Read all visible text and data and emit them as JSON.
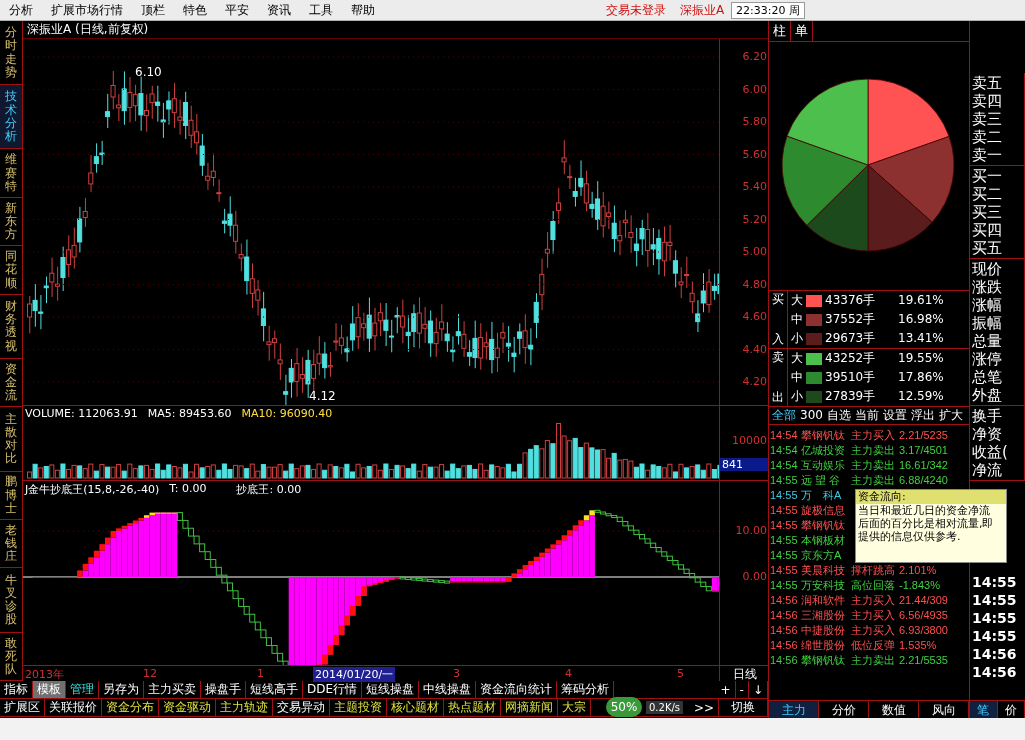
{
  "menu": {
    "items": [
      "分析",
      "扩展市场行情",
      "顶栏",
      "特色",
      "平安",
      "资讯",
      "工具",
      "帮助"
    ],
    "status": [
      "交易未登录",
      "深振业A"
    ],
    "clock": "22:33:20 周"
  },
  "left_tabs": [
    {
      "label": "分时走势",
      "selected": false
    },
    {
      "label": "技术分析",
      "selected": true
    },
    {
      "label": "维赛特",
      "selected": false
    },
    {
      "label": "新东方",
      "selected": false
    },
    {
      "label": "同花顺",
      "selected": false
    },
    {
      "label": "财务透视",
      "selected": false
    },
    {
      "label": "资金流",
      "selected": false
    },
    {
      "label": "主散对比",
      "selected": false
    },
    {
      "label": "鹏博士",
      "selected": false
    },
    {
      "label": "老钱庄",
      "selected": false
    },
    {
      "label": "牛叉诊股",
      "selected": false
    },
    {
      "label": "敢死队",
      "selected": false
    }
  ],
  "price_chart": {
    "title": "深振业A (日线,前复权)",
    "high_label": "6.10",
    "low_label": "4.12",
    "axis": [
      "6.20",
      "6.00",
      "5.80",
      "5.60",
      "5.40",
      "5.20",
      "5.00",
      "4.80",
      "4.60",
      "4.40",
      "4.20"
    ]
  },
  "volume_chart": {
    "readings": [
      "VOLUME: 112063.91",
      "MA5: 89453.60",
      "MA10: 96090.40"
    ],
    "axis": [
      "10000"
    ],
    "cursor_value": "841"
  },
  "indicator_chart": {
    "name": "J金牛抄底王(15,8,-26,-40)",
    "t_reading": "T: 0.00",
    "reading": "抄底王: 0.00",
    "axis": [
      "10.00",
      "0.00"
    ]
  },
  "x_axis": {
    "labels": [
      {
        "label": "2013年",
        "selected": false
      },
      {
        "label": "12",
        "selected": false
      },
      {
        "label": "1",
        "selected": false
      },
      {
        "label": "2014/01/20/一",
        "selected": true
      },
      {
        "label": "3",
        "selected": false
      },
      {
        "label": "4",
        "selected": false
      },
      {
        "label": "5",
        "selected": false
      }
    ],
    "period": "日线"
  },
  "toolbar": [
    {
      "label": "指标",
      "selected": false
    },
    {
      "label": "模板",
      "selected": true
    },
    {
      "label": "管理",
      "selected": false,
      "kind": "active"
    },
    {
      "label": "另存为",
      "selected": false
    },
    {
      "label": "主力买卖",
      "selected": false
    },
    {
      "label": "操盘手",
      "selected": false
    },
    {
      "label": "短线高手",
      "selected": false
    },
    {
      "label": "DDE行情",
      "selected": false
    },
    {
      "label": "短线操盘",
      "selected": false
    },
    {
      "label": "中线操盘",
      "selected": false
    },
    {
      "label": "资金流向统计",
      "selected": false
    },
    {
      "label": "筹码分析",
      "selected": false
    }
  ],
  "zoom_buttons": [
    "+",
    "-",
    "↓"
  ],
  "ext_bar": [
    {
      "label": "扩展区",
      "kind": "basic"
    },
    {
      "label": "关联报价",
      "kind": "basic"
    },
    {
      "label": "资金分布",
      "kind": "feature"
    },
    {
      "label": "资金驱动",
      "kind": "feature"
    },
    {
      "label": "主力轨迹",
      "kind": "feature"
    },
    {
      "label": "交易异动",
      "kind": "basic"
    },
    {
      "label": "主题投资",
      "kind": "feature"
    },
    {
      "label": "核心题材",
      "kind": "feature"
    },
    {
      "label": "热点题材",
      "kind": "feature"
    },
    {
      "label": "网摘新闻",
      "kind": "feature"
    },
    {
      "label": "大宗",
      "kind": "feature"
    }
  ],
  "ext_more": ">>",
  "switch_button": "切换",
  "net_widget": {
    "percent": "50%",
    "speed": "0.2K/s"
  },
  "right_panel": {
    "tabs": [
      {
        "label": "柱",
        "selected": false
      },
      {
        "label": "单",
        "selected": false
      }
    ],
    "pie": {
      "chart_data": {
        "type": "pie",
        "series": [
          {
            "values": [
              19.61,
              16.98,
              13.41,
              12.59,
              17.86,
              19.55
            ]
          }
        ]
      }
    },
    "legend": [
      {
        "top": "买",
        "bottom": "入",
        "rows": [
          {
            "size": "大",
            "color": "#ff5252",
            "volume": "43376手",
            "percent": "19.61%"
          },
          {
            "size": "中",
            "color": "#8c3030",
            "volume": "37552手",
            "percent": "16.98%"
          },
          {
            "size": "小",
            "color": "#5a1c1c",
            "volume": "29673手",
            "percent": "13.41%"
          }
        ]
      },
      {
        "top": "卖",
        "bottom": "出",
        "rows": [
          {
            "size": "大",
            "color": "#4cbf4c",
            "volume": "43252手",
            "percent": "19.55%"
          },
          {
            "size": "中",
            "color": "#2e8a2e",
            "volume": "39510手",
            "percent": "17.86%"
          },
          {
            "size": "小",
            "color": "#1c4a1c",
            "volume": "27839手",
            "percent": "12.59%"
          }
        ]
      }
    ],
    "filters": [
      {
        "label": "全部",
        "selected": true
      },
      {
        "label": "300",
        "selected": false
      },
      {
        "label": "自选",
        "selected": false
      },
      {
        "label": "当前",
        "selected": false
      },
      {
        "label": "设置",
        "selected": false
      },
      {
        "label": "浮出",
        "selected": false
      },
      {
        "label": "扩大",
        "selected": false
      }
    ],
    "stream": [
      {
        "time": "14:54",
        "stock": "攀钢钒钛",
        "action": "主力买入",
        "value": "2.21/5235",
        "color": "#ff5050"
      },
      {
        "time": "14:54",
        "stock": "亿城投资",
        "action": "主力卖出",
        "value": "3.17/4501",
        "color": "#40d040"
      },
      {
        "time": "14:54",
        "stock": "互动娱乐",
        "action": "主力卖出",
        "value": "16.61/342",
        "color": "#40d040"
      },
      {
        "time": "14:55",
        "stock": "远 望 谷",
        "action": "主力卖出",
        "value": "6.88/4240",
        "color": "#40d040"
      },
      {
        "time": "14:55",
        "stock": "万　科A",
        "color": "#40c8e0"
      },
      {
        "time": "14:55",
        "stock": "旋极信息",
        "color": "#ff5050"
      },
      {
        "time": "14:55",
        "stock": "攀钢钒钛",
        "color": "#ff5050"
      },
      {
        "time": "14:55",
        "stock": "本钢板材",
        "color": "#40d040"
      },
      {
        "time": "14:55",
        "stock": "京东方A",
        "color": "#40d040"
      },
      {
        "time": "14:55",
        "stock": "美晨科技",
        "action": "撑杆跳高",
        "value": "2.101%",
        "color": "#ff5050"
      },
      {
        "time": "14:55",
        "stock": "万安科技",
        "action": "高位回落",
        "value": "-1.843%",
        "color": "#40d040"
      },
      {
        "time": "14:56",
        "stock": "润和软件",
        "action": "主力买入",
        "value": "21.44/309",
        "color": "#ff5050"
      },
      {
        "time": "14:56",
        "stock": "三湘股份",
        "action": "主力买入",
        "value": "6.56/4935",
        "color": "#ff5050"
      },
      {
        "time": "14:56",
        "stock": "中捷股份",
        "action": "主力买入",
        "value": "6.93/3800",
        "color": "#ff5050"
      },
      {
        "time": "14:56",
        "stock": "绵世股份",
        "action": "低位反弹",
        "value": "1.535%",
        "color": "#ff5050"
      },
      {
        "time": "14:56",
        "stock": "攀钢钒钛",
        "action": "主力卖出",
        "value": "2.21/5535",
        "color": "#40d040"
      }
    ],
    "tooltip": {
      "title": "资金流向:",
      "lines": [
        "当日和最近几日的资金净流",
        "后面的百分比是相对流量,即",
        "提供的信息仅供参考."
      ]
    },
    "bottom_tabs": [
      {
        "label": "主力",
        "selected": true
      },
      {
        "label": "分价",
        "selected": false
      },
      {
        "label": "数值",
        "selected": false
      },
      {
        "label": "风向",
        "selected": false
      }
    ]
  },
  "quote_column": {
    "groups": [
      [
        "卖五",
        "卖四",
        "卖三",
        "卖二",
        "卖一"
      ],
      [
        "买一",
        "买二",
        "买三",
        "买四",
        "买五"
      ],
      [
        "现价",
        "涨跌",
        "涨幅",
        "振幅",
        "总量",
        "涨停",
        "总笔",
        "外盘"
      ],
      [
        "换手",
        "净资",
        "收益(",
        "净流"
      ]
    ],
    "times": [
      "14:55",
      "14:55",
      "14:55",
      "14:55",
      "14:56",
      "14:56"
    ],
    "tabs": [
      {
        "label": "笔",
        "selected": true
      },
      {
        "label": "价",
        "selected": false
      }
    ]
  }
}
